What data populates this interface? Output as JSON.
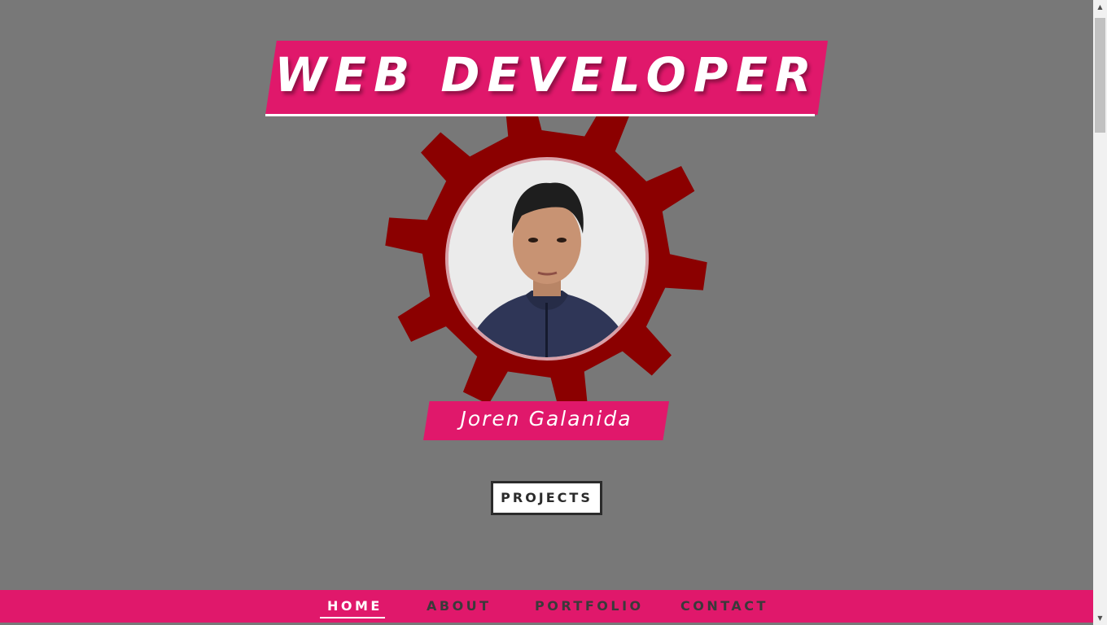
{
  "header": {
    "title": "WEB DEVELOPER"
  },
  "profile": {
    "name": "Joren Galanida",
    "avatar_alt": "profile photo"
  },
  "actions": {
    "projects_label": "PROJECTS"
  },
  "nav": {
    "items": [
      {
        "label": "HOME",
        "active": true
      },
      {
        "label": "ABOUT",
        "active": false
      },
      {
        "label": "PORTFOLIO",
        "active": false
      },
      {
        "label": "CONTACT",
        "active": false
      }
    ]
  },
  "scrollbar": {
    "up_icon": "▲",
    "down_icon": "▼"
  },
  "colors": {
    "accent": "#e0186b",
    "gear": "#8b0000",
    "background": "#787878"
  }
}
